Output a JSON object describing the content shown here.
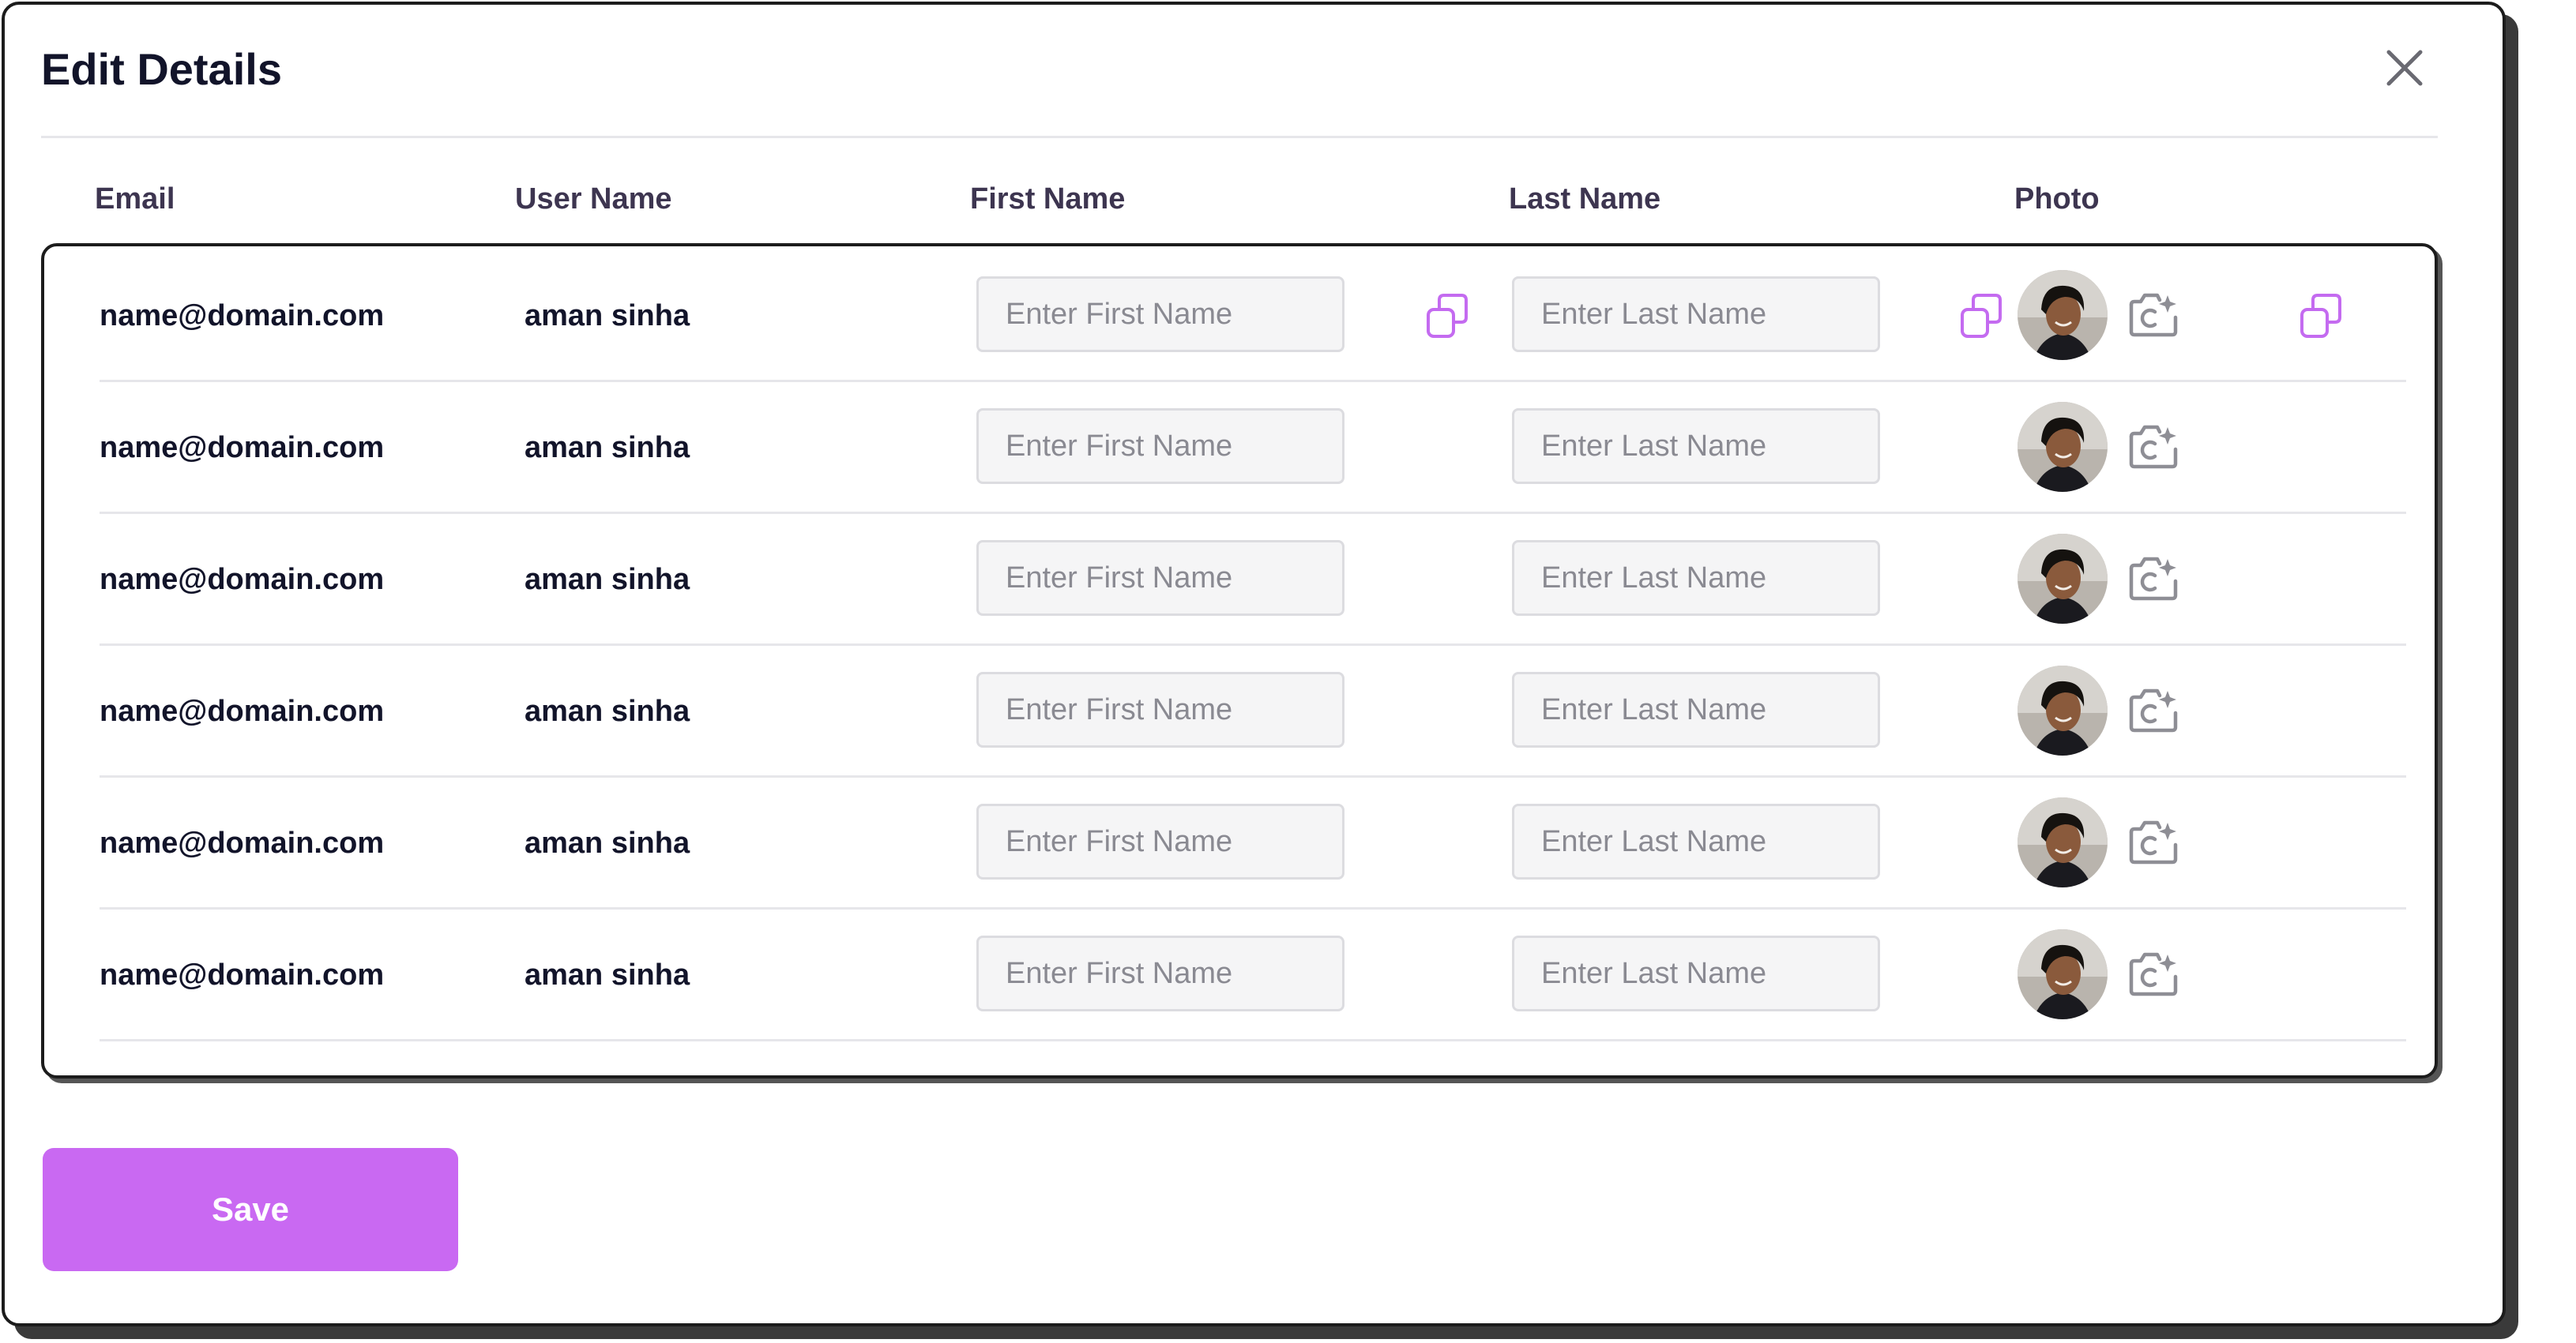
{
  "modal": {
    "title": "Edit Details",
    "close_icon": "close-icon"
  },
  "columns": {
    "email": "Email",
    "username": "User Name",
    "first_name": "First Name",
    "last_name": "Last Name",
    "photo": "Photo"
  },
  "rows": [
    {
      "email": "name@domain.com",
      "username": "aman sinha",
      "first_name": "",
      "last_name": ""
    },
    {
      "email": "name@domain.com",
      "username": "aman sinha",
      "first_name": "",
      "last_name": ""
    },
    {
      "email": "name@domain.com",
      "username": "aman sinha",
      "first_name": "",
      "last_name": ""
    },
    {
      "email": "name@domain.com",
      "username": "aman sinha",
      "first_name": "",
      "last_name": ""
    },
    {
      "email": "name@domain.com",
      "username": "aman sinha",
      "first_name": "",
      "last_name": ""
    },
    {
      "email": "name@domain.com",
      "username": "aman sinha",
      "first_name": "",
      "last_name": ""
    }
  ],
  "placeholders": {
    "first_name": "Enter First Name",
    "last_name": "Enter Last Name"
  },
  "icons": {
    "copy": "copy-icon",
    "camera": "camera-add-icon",
    "avatar": "avatar"
  },
  "actions": {
    "save_label": "Save"
  },
  "colors": {
    "accent": "#c969f2",
    "copy_icon": "#c46bf0",
    "border": "#1c1c1c",
    "input_bg": "#f5f5f6"
  }
}
